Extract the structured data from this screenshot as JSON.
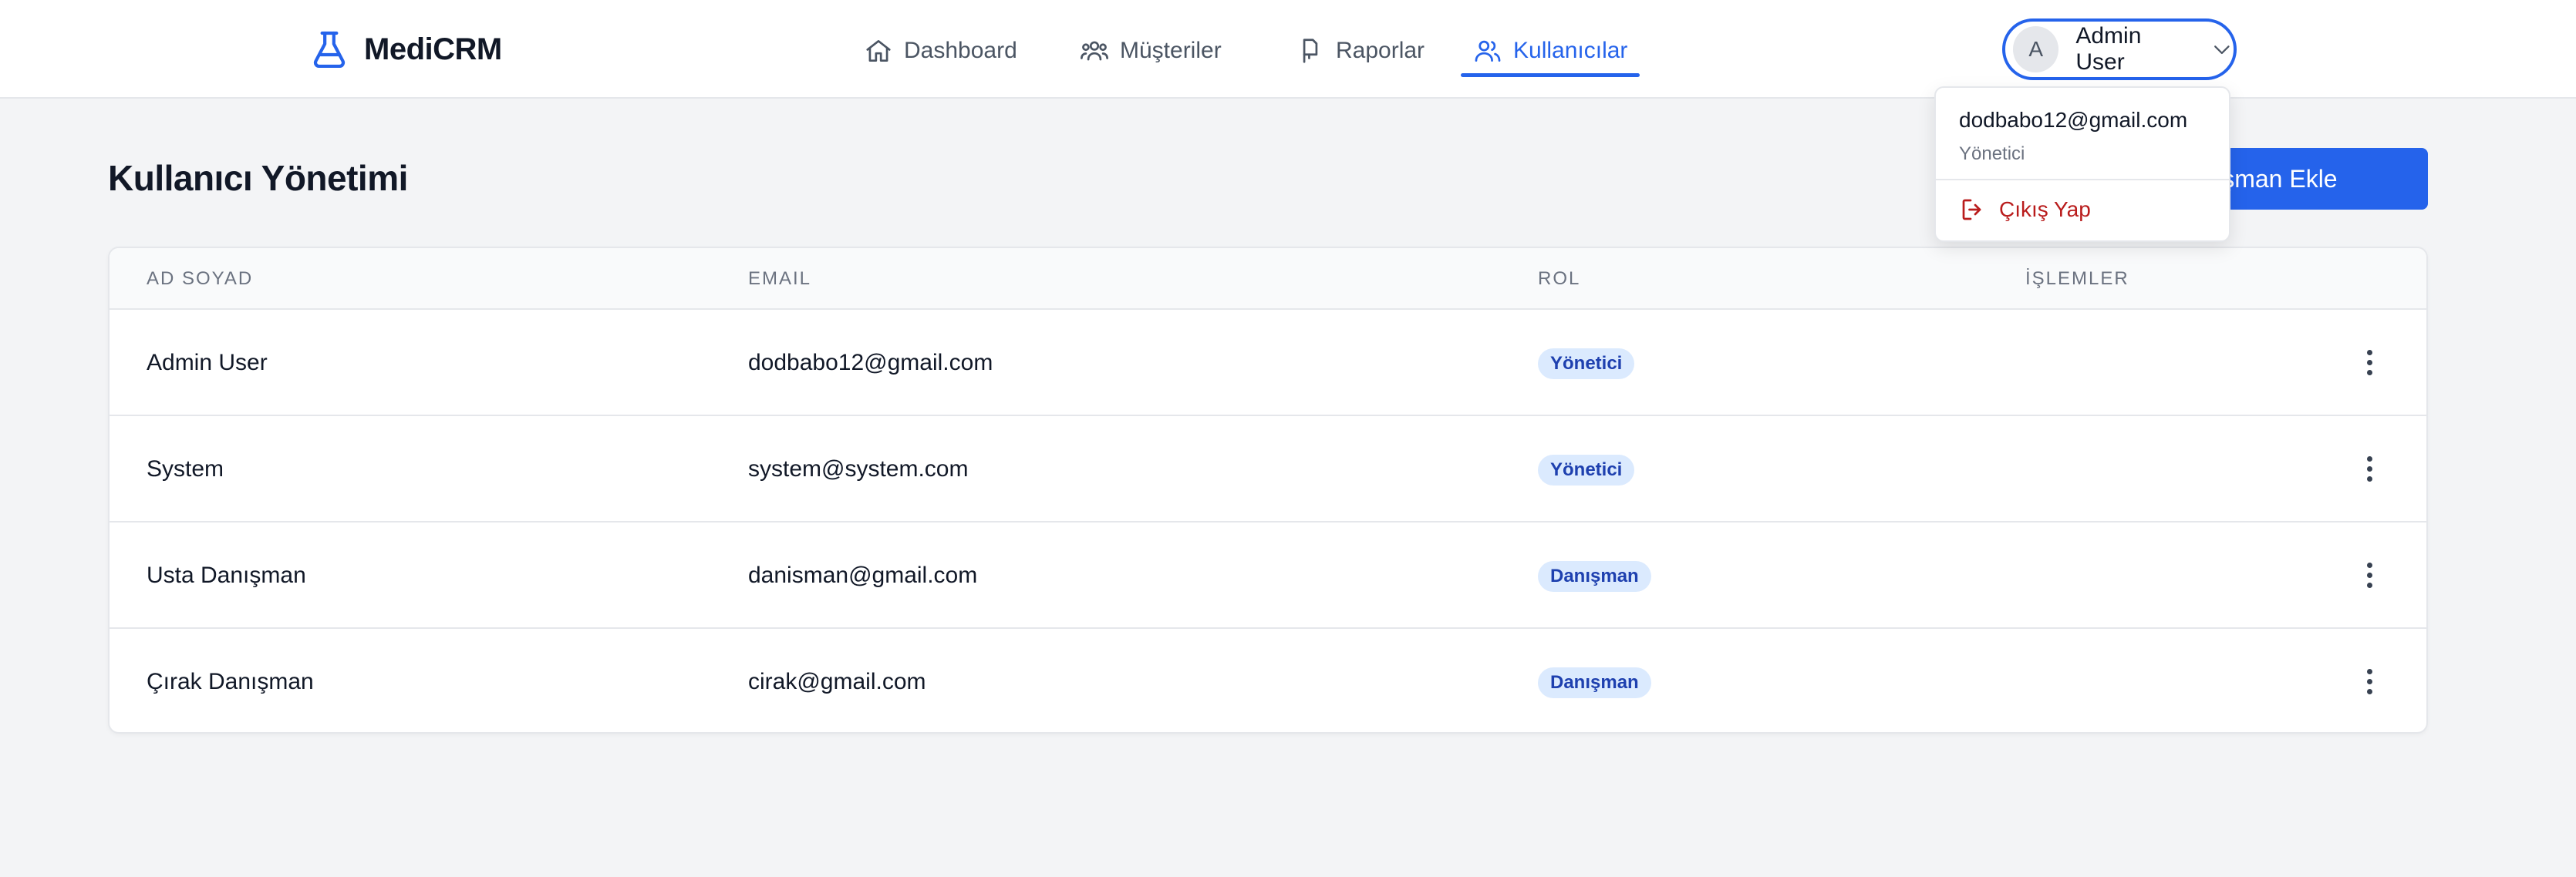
{
  "brand": {
    "name": "MediCRM"
  },
  "nav": {
    "items": [
      {
        "label": "Dashboard",
        "icon": "home-icon"
      },
      {
        "label": "Müşteriler",
        "icon": "users-group-icon"
      },
      {
        "label": "Raporlar",
        "icon": "report-icon"
      },
      {
        "label": "Kullanıcılar",
        "icon": "user-icon",
        "active": true
      }
    ]
  },
  "user_menu": {
    "avatar_initial": "A",
    "name": "Admin User",
    "dropdown": {
      "email": "dodbabo12@gmail.com",
      "role": "Yönetici",
      "logout_label": "Çıkış Yap"
    }
  },
  "page": {
    "title": "Kullanıcı Yönetimi",
    "add_button_label": "Danışman Ekle"
  },
  "table": {
    "headers": {
      "name": "AD SOYAD",
      "email": "EMAIL",
      "role": "ROL",
      "actions": "İŞLEMLER"
    },
    "rows": [
      {
        "name": "Admin User",
        "email": "dodbabo12@gmail.com",
        "role": "Yönetici"
      },
      {
        "name": "System",
        "email": "system@system.com",
        "role": "Yönetici"
      },
      {
        "name": "Usta Danışman",
        "email": "danisman@gmail.com",
        "role": "Danışman"
      },
      {
        "name": "Çırak Danışman",
        "email": "cirak@gmail.com",
        "role": "Danışman"
      }
    ]
  },
  "colors": {
    "accent": "#2563eb",
    "badge_bg": "#dbeafe",
    "badge_text": "#1e40af",
    "logout": "#b91c1c"
  }
}
